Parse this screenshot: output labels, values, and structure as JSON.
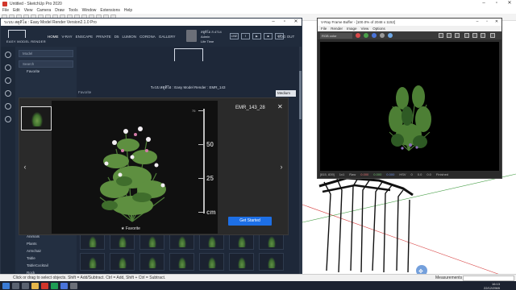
{
  "sketchup": {
    "title": "Untitled - SketchUp Pro 2020",
    "menu": [
      "File",
      "Edit",
      "View",
      "Camera",
      "Draw",
      "Tools",
      "Window",
      "Extensions",
      "Help"
    ],
    "status": "Click or drag to select objects. Shift = Add/Subtract. Ctrl = Add, Shift + Ctrl = Subtract.",
    "measurements_label": "Measurements"
  },
  "taskbar": {
    "time": "16:13",
    "date": "22/12/2565"
  },
  "emr": {
    "title": "ระบบ สตูดิโอ : Easy Model Render Version2.1.0 Pro",
    "logo_label": "EASY MODEL RENDER",
    "nav": [
      "HOME",
      "V-RAY",
      "ENSCAPE",
      "PRIVATE",
      "D5",
      "LUMION",
      "CORONA",
      "GALLERY"
    ],
    "user": {
      "line1": "สตูดิโอ ส.4714",
      "line2": "Admin",
      "line3": "Life Time"
    },
    "social": [
      "LINE",
      "f",
      "▶",
      "◙",
      "VIP"
    ],
    "logout": "LOG OUT",
    "search_placeholder": "Search",
    "model_select": "Model",
    "favorite_tree": "Favorite",
    "subtitle": "ระบบ สตูดิโอ : Easy Model Render : EMR_143",
    "medium_label": "Medium",
    "favorite_label": "Favorite",
    "categories": [
      "Animals",
      "Plants",
      "Armchair",
      "Table",
      "TableCocktail",
      "Rock",
      "Rug Mat"
    ]
  },
  "modal": {
    "model_name": "EMR_143_28",
    "close_icon": "close-icon",
    "start_label": "Get Started",
    "favorite_label": "Favorite",
    "ruler": {
      "labels": [
        "75",
        "50",
        "25",
        "cm"
      ],
      "minor": [
        "70",
        "60",
        "50",
        "40",
        "30",
        "20",
        "10"
      ]
    }
  },
  "vfb": {
    "title": "V-Ray Frame Buffer - [100.0% of 2048 x 1152]",
    "menu": [
      "File",
      "Render",
      "Image",
      "View",
      "Options"
    ],
    "channel": "RGB color",
    "status_coords": "[815, 839]",
    "status_zoom": "1x1",
    "status_mode": "Raw",
    "status_values": [
      "0.000",
      "0.000",
      "0.000"
    ],
    "status_hsv": "HSV",
    "status_h": "0",
    "status_s": "0.0",
    "status_v": "0.0",
    "status_finished": "Finished"
  }
}
